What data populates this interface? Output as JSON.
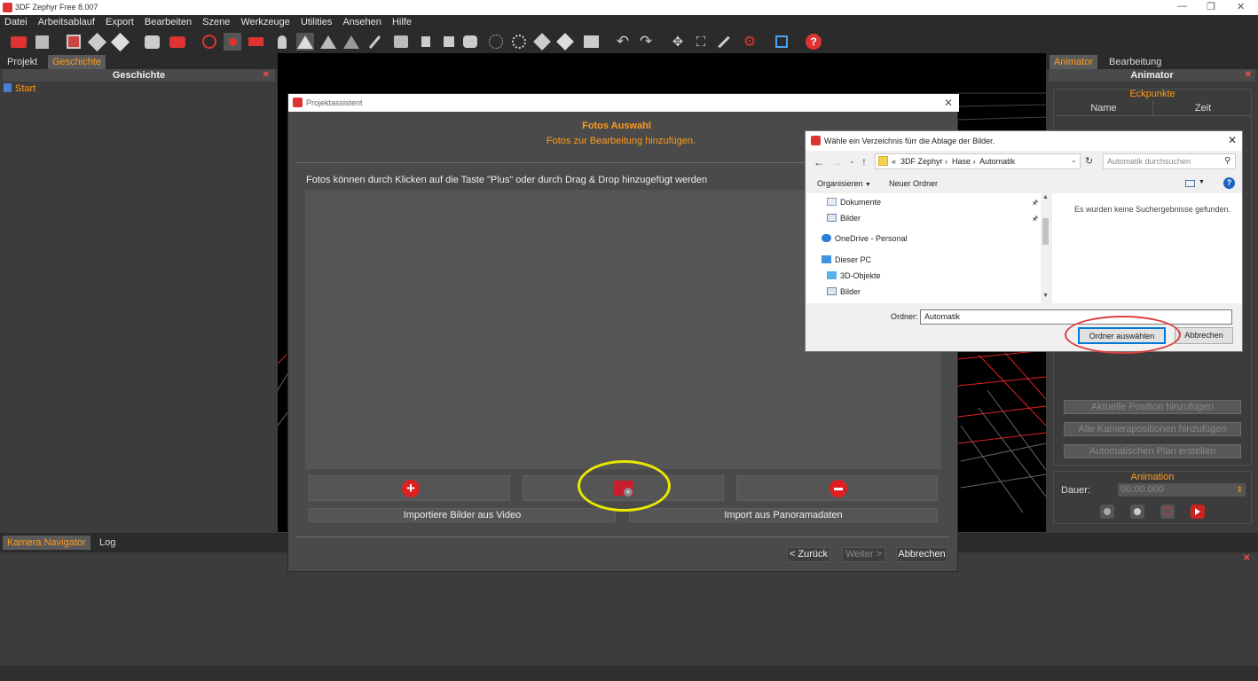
{
  "window": {
    "title": "3DF Zephyr Free 8.007"
  },
  "menu": [
    "Datei",
    "Arbeitsablauf",
    "Export",
    "Bearbeiten",
    "Szene",
    "Werkzeuge",
    "Utilities",
    "Ansehen",
    "Hilfe"
  ],
  "left_panel": {
    "tabs": [
      "Projekt",
      "Geschichte"
    ],
    "active_tab": "Geschichte",
    "header": "Geschichte",
    "items": [
      "Start"
    ]
  },
  "right_panel": {
    "tabs": [
      "Animator",
      "Bearbeitung"
    ],
    "active_tab": "Animator",
    "header": "Animator",
    "section_keypoints": "Eckpunkte",
    "table_headers": [
      "Name",
      "Zeit"
    ],
    "buttons": [
      "Aktuelle Position hinzufügen",
      "Alle Kamerapositionen hinzufügen",
      "Automatischen Plan erstellen"
    ],
    "animation_title": "Animation",
    "duration_label": "Dauer:",
    "duration_value": "00:00.000"
  },
  "bottom_panel": {
    "tabs": [
      "Kamera Navigator",
      "Log"
    ],
    "active_tab": "Kamera Navigator"
  },
  "wizard": {
    "title": "Projektassistent",
    "heading": "Fotos Auswahl",
    "subheading": "Fotos zur Bearbeitung hinzufügen.",
    "instruction": "Fotos können durch Klicken auf die Taste \"Plus\" oder durch Drag & Drop hinzugefügt werden",
    "import_video": "Importiere Bilder aus Video",
    "import_panorama": "Import aus Panoramadaten",
    "back": "< Zurück",
    "next": "Weiter >",
    "cancel": "Abbrechen"
  },
  "dialog": {
    "title": "Wähle ein Verzeichnis fürr die Ablage der Bilder.",
    "breadcrumb": [
      "«",
      "3DF Zephyr",
      "Hase",
      "Automatik"
    ],
    "search_placeholder": "Automatik durchsuchen",
    "organize": "Organisieren",
    "new_folder": "Neuer Ordner",
    "tree": [
      "Dokumente",
      "Bilder",
      "OneDrive - Personal",
      "Dieser PC",
      "3D-Objekte",
      "Bilder"
    ],
    "no_results": "Es wurden keine Suchergebnisse gefunden.",
    "folder_label": "Ordner:",
    "folder_value": "Automatik",
    "select_button": "Ordner auswählen",
    "cancel_button": "Abbrechen"
  },
  "colors": {
    "accent": "#ff9b1a",
    "highlight_red": "#c0392b",
    "annotation_yellow": "#e8e800",
    "annotation_red": "#d94040"
  }
}
